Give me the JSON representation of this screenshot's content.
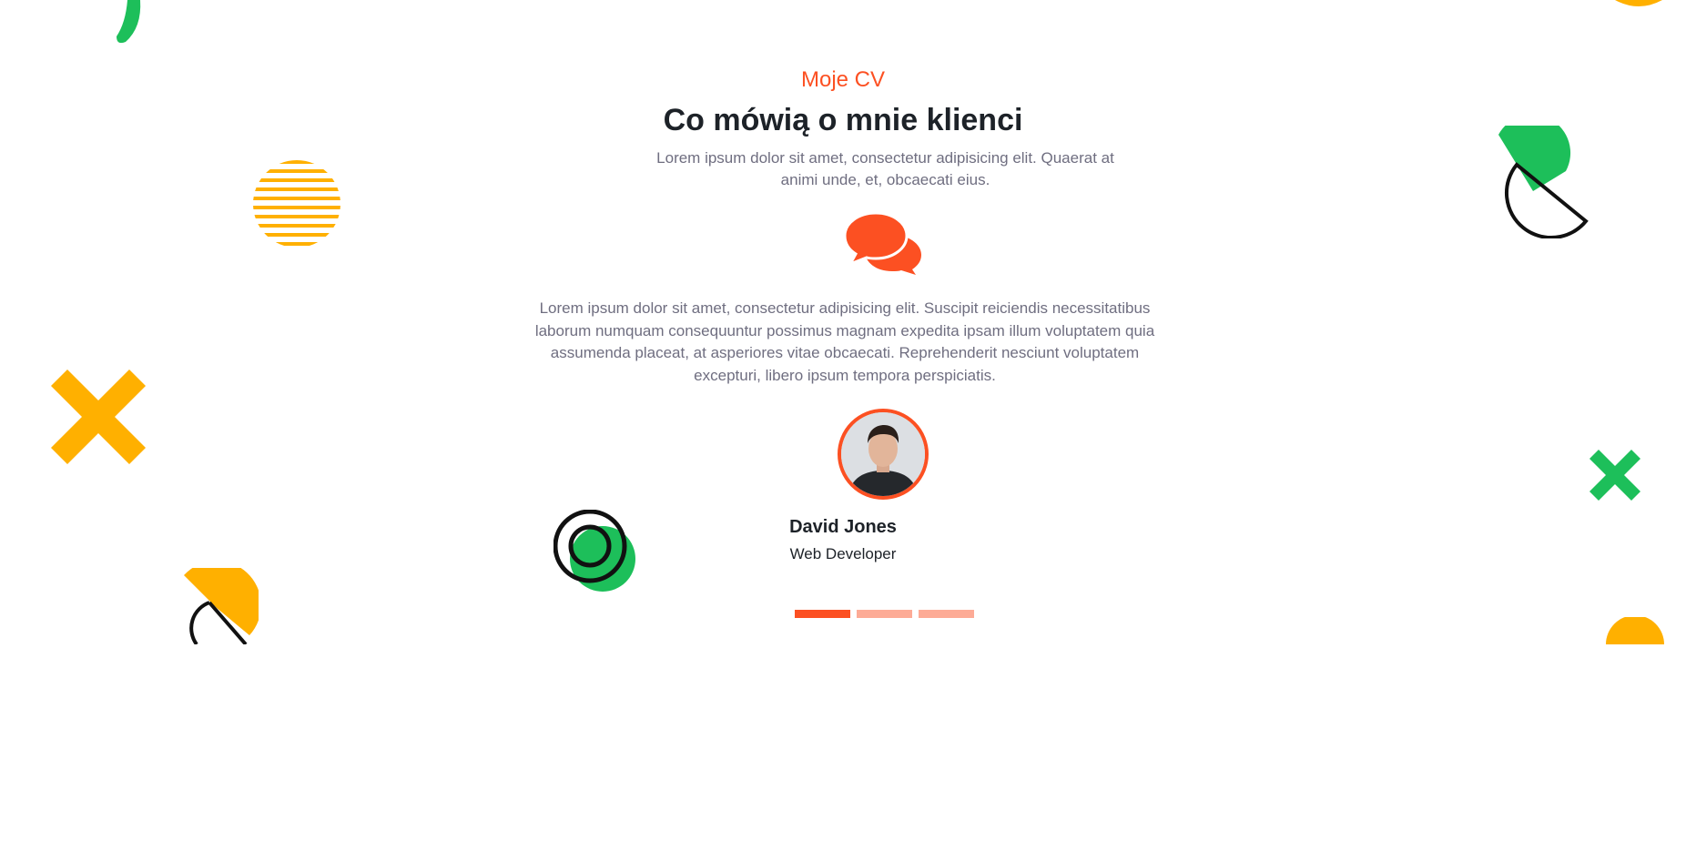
{
  "testimonials": {
    "eyebrow": "Moje CV",
    "title": "Co mówią o mnie klienci",
    "lead": "Lorem ipsum dolor sit amet, consectetur adipisicing elit. Quaerat at animi unde, et, obcaecati eius.",
    "icon": "comments-icon",
    "quote": "Lorem ipsum dolor sit amet, consectetur adipisicing elit. Suscipit reiciendis necessitatibus laborum numquam consequuntur possimus magnam expedita ipsam illum voluptatem quia assumenda placeat, at asperiores vitae obcaecati. Reprehenderit nesciunt voluptatem excepturi, libero ipsum tempora perspiciatis.",
    "person": {
      "name": "David Jones",
      "role": "Web Developer"
    },
    "slider": {
      "slides": 3,
      "active": 1
    }
  },
  "colors": {
    "accent": "#fc5022",
    "accent_light": "#fdab96",
    "heading": "#1d2228",
    "text": "#6f6e80",
    "green": "#1dbf5a",
    "yellow": "#ffb000"
  }
}
